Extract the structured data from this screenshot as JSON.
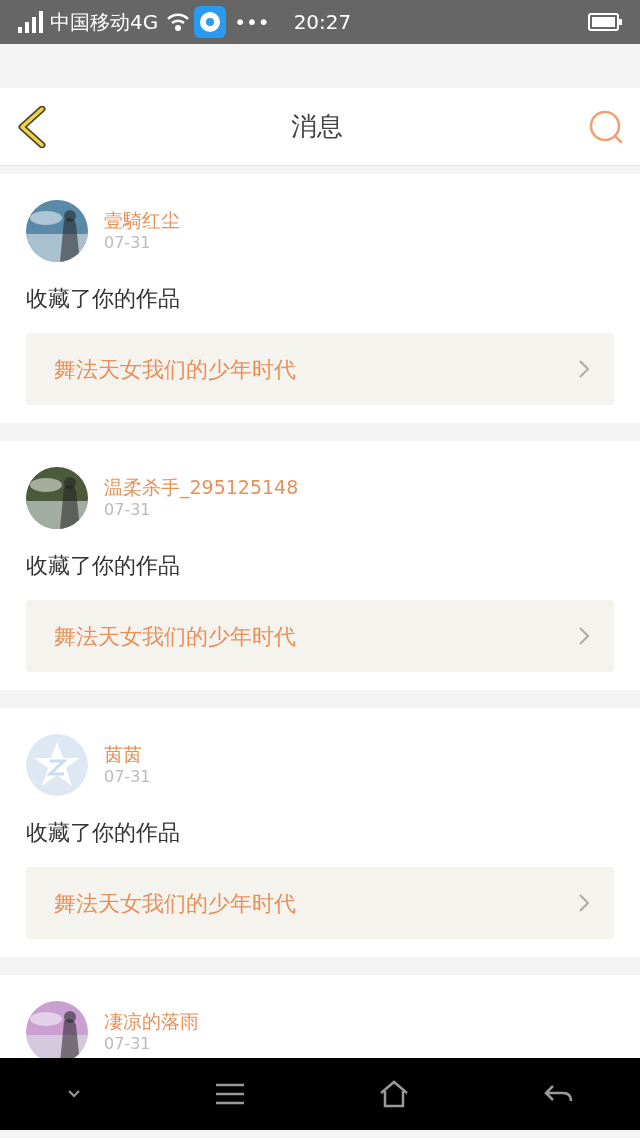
{
  "status_bar": {
    "carrier": "中国移动4G",
    "more": "•••",
    "time": "20:27"
  },
  "header": {
    "title": "消息"
  },
  "messages": [
    {
      "user": "壹騎红尘",
      "date": "07-31",
      "action": "收藏了你的作品",
      "work": "舞法天女我们的少年时代"
    },
    {
      "user": "温柔杀手_295125148",
      "date": "07-31",
      "action": "收藏了你的作品",
      "work": "舞法天女我们的少年时代"
    },
    {
      "user": "茵茵",
      "date": "07-31",
      "action": "收藏了你的作品",
      "work": "舞法天女我们的少年时代",
      "avatar": {
        "kind": "default"
      }
    },
    {
      "user": "凄凉的落雨",
      "date": "07-31"
    }
  ]
}
